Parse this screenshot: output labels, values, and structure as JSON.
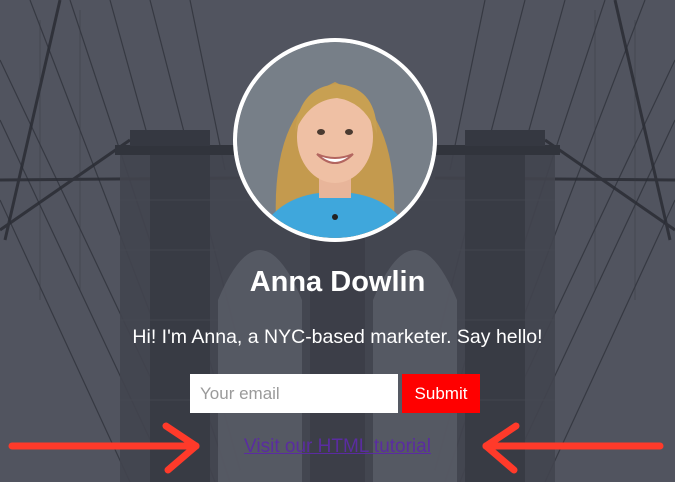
{
  "profile": {
    "name": "Anna Dowlin",
    "tagline": "Hi! I'm Anna, a NYC-based marketer. Say hello!"
  },
  "form": {
    "email_placeholder": "Your email",
    "submit_label": "Submit"
  },
  "footer": {
    "link_text": "Visit our HTML tutorial"
  },
  "colors": {
    "overlay": "#5a5d68",
    "submit_bg": "#ff0000",
    "link": "#5a2ca0",
    "annotation_arrow": "#ff3a2a",
    "avatar_ring": "#ffffff"
  },
  "icons": {
    "left_arrow": "right-pointing-arrow-icon",
    "right_arrow": "left-pointing-arrow-icon"
  }
}
